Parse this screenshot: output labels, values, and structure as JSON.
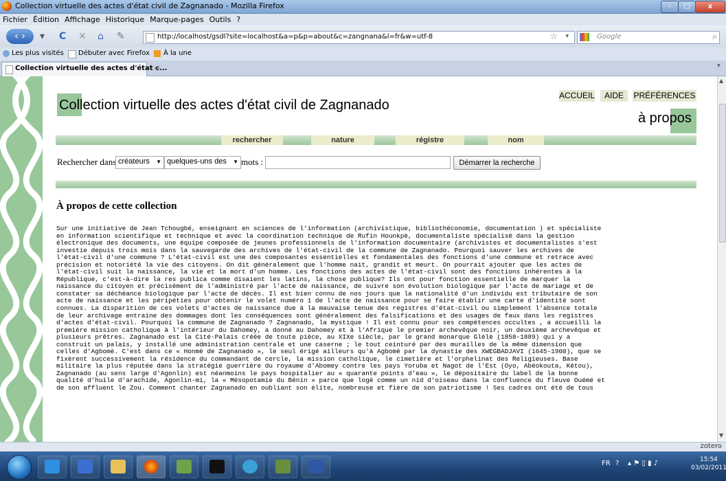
{
  "window": {
    "title": "Collection virtuelle des actes d'état civil de Zagnanado - Mozilla Firefox"
  },
  "menu": [
    "Fichier",
    "Édition",
    "Affichage",
    "Historique",
    "Marque-pages",
    "Outils",
    "?"
  ],
  "nav": {
    "url": "http://localhost/gsdl?site=localhost&a=p&p=about&c=zangnana&l=fr&w=utf-8",
    "search_placeholder": "Google"
  },
  "bookmarks": [
    "Les plus visités",
    "Débuter avec Firefox",
    "À la une"
  ],
  "tab": {
    "label": "Collection virtuelle des actes d'état c...",
    "new_tab": "+"
  },
  "page": {
    "collection_title": "Collection virtuelle des actes d'état civil de Zagnanado",
    "top_links": [
      "ACCUEIL",
      "AIDE",
      "PRÉFÉRENCES"
    ],
    "page_name": "à propos",
    "nav_tabs": [
      "rechercher",
      "nature",
      "régistre",
      "nom"
    ],
    "search": {
      "prefix": "Rechercher dans",
      "field": "créateurs",
      "mode": "quelques-uns des",
      "suffix": "mots :",
      "query": "",
      "button": "Démarrer la recherche"
    },
    "section_title": "À propos de cette collection",
    "body_lines": [
      "Sur une initiative de Jean Tchougbé, enseignant en sciences de l'information (archivistique, bibliothéconomie, documentation ) et spécialiste",
      "en information scientifique et technique et avec la coordination technique de Rufin Hounkpè, documentaliste spécialisé dans la gestion",
      "électronique des documents, une équipe composée de jeunes professionnels de l'information documentaire (archivistes et documentalistes s'est",
      "investie depuis trois mois dans la sauvegarde des archives de l'état-civil de la commune de Zagnanado. Pourquoi sauver les archives de",
      "l'état-civil d'une commune ? L'état-civil est une des composantes essentielles et fondamentales des fonctions d'une commune et retrace avec",
      "précision et notoriété la vie des citoyens. On dit généralement que l'homme nait, grandit et meurt. On pourrait ajouter que les actes de",
      "l'état-civil suit la naissance, la vie et la mort d'un homme. Les fonctions des actes de l'état-civil sont des fonctions inhérentes à la",
      "République, c'est-à-dire la res publica comme disaient les latins, la chose publique? Ils ont pour fonction essentielle de marquer la",
      "naissance du citoyen et précisément de l'administré par l'acte de naissance, de suivre son évolution biologique par l'acte de mariage et de",
      "constater sa déchéance biologique par l'acte de décès. Il est bien connu de nos jours que la nationalité d'un individu est tributaire de son",
      "acte de naissance et les péripéties pour obtenir le volet numéro 1 de l'acte de naissance pour se faire établir une carte d'identité sont",
      "connues. La disparition de ces volets d'actes de naissance due à la mauvaise tenue des registres d'état-civil ou simplement l'absence totale",
      "de leur archivage entraine des dommages dont les conséquences sont généralement des falsifications et des usages de faux dans les registres",
      "d'actes d'état-civil. Pourquoi la commune de Zagnanado ? Zagnanado, la mystique ! Il est connu pour ses compétences occultes , a accueilli la",
      "première mission catholique à l'intérieur du Dahomey, a donné au Dahomey et à l'Afrique le premier archevêque noir, un deuxième archevêque et",
      "plusieurs prêtres. Zagnanado est la Cité-Palais créée de toute pièce, au XIXe siècle, par le grand monarque Glèlè (1858-1889) qui y a",
      "construit un palais, y installé une administration centrale et une caserne ; le tout ceinturé par des murailles de la même dimension que",
      "celles d'Agbomè. C'est dans ce « Honmè de Zagnanado », le seul érigé ailleurs qu'à Agbomè par la dynastie des XWEGBADJAVI (1645-1900), que se",
      "fixèrent successivement la résidence du commandant de cercle, la mission catholique, le cimetière et l'orphelinat des Religieuses. Base",
      "militaire la plus réputée dans la stratégie guerrière du royaume d'Abomey contre les pays Yoruba et Nagot de l'Est (Oyo, Abéokouta, Kétou),",
      "Zagnanado (au sens large d'Agonlin) est néanmoins le pays hospitalier au « quarante points d'eau », le dépositaire du label de la bonne",
      "qualité d'huile d'arachide, Agonlin-mi, la « Mésopotamie du Bénin » parce que logé comme un nid d'oiseau dans la confluence du fleuve Ouémé et",
      "de son affluent le Zou. Comment chanter Zagnanado en oubliant son élite, nombreuse et fière de son patriotisme ! Ses cadres ont été de tous"
    ]
  },
  "status": {
    "zotero": "zotero"
  },
  "taskbar": {
    "lang": "FR",
    "time": "15:54",
    "date": "03/02/2011"
  },
  "colors": {
    "accent_green": "#98c79a",
    "tab_bg": "#eaeccb"
  }
}
